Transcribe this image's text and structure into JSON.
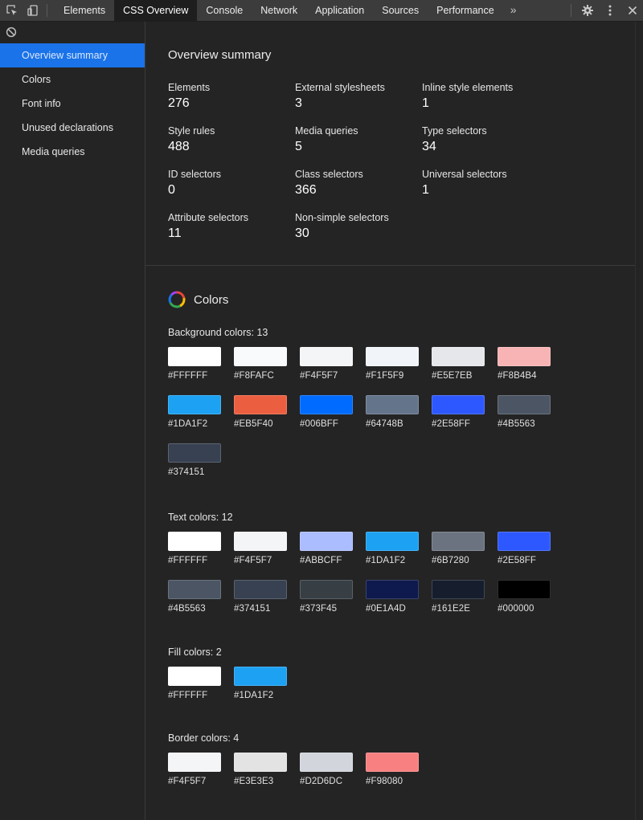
{
  "toolbar": {
    "tabs": [
      "Elements",
      "CSS Overview",
      "Console",
      "Network",
      "Application",
      "Sources",
      "Performance"
    ],
    "active_tab": "CSS Overview",
    "more_tabs": "»",
    "icons": [
      "inspect-element-icon",
      "device-toolbar-icon",
      "gear-icon",
      "kebab-menu-icon",
      "close-icon"
    ]
  },
  "sidebar": {
    "items": [
      "Overview summary",
      "Colors",
      "Font info",
      "Unused declarations",
      "Media queries"
    ],
    "active": "Overview summary"
  },
  "summary": {
    "title": "Overview summary",
    "stats": [
      {
        "label": "Elements",
        "value": "276"
      },
      {
        "label": "External stylesheets",
        "value": "3"
      },
      {
        "label": "Inline style elements",
        "value": "1"
      },
      {
        "label": "Style rules",
        "value": "488"
      },
      {
        "label": "Media queries",
        "value": "5"
      },
      {
        "label": "Type selectors",
        "value": "34"
      },
      {
        "label": "ID selectors",
        "value": "0"
      },
      {
        "label": "Class selectors",
        "value": "366"
      },
      {
        "label": "Universal selectors",
        "value": "1"
      },
      {
        "label": "Attribute selectors",
        "value": "11"
      },
      {
        "label": "Non-simple selectors",
        "value": "30"
      }
    ]
  },
  "colors": {
    "title": "Colors",
    "groups": [
      {
        "title": "Background colors: 13",
        "colors": [
          "#FFFFFF",
          "#F8FAFC",
          "#F4F5F7",
          "#F1F5F9",
          "#E5E7EB",
          "#F8B4B4",
          "#1DA1F2",
          "#EB5F40",
          "#006BFF",
          "#64748B",
          "#2E58FF",
          "#4B5563",
          "#374151"
        ]
      },
      {
        "title": "Text colors: 12",
        "colors": [
          "#FFFFFF",
          "#F4F5F7",
          "#ABBCFF",
          "#1DA1F2",
          "#6B7280",
          "#2E58FF",
          "#4B5563",
          "#374151",
          "#373F45",
          "#0E1A4D",
          "#161E2E",
          "#000000"
        ]
      },
      {
        "title": "Fill colors: 2",
        "colors": [
          "#FFFFFF",
          "#1DA1F2"
        ]
      },
      {
        "title": "Border colors: 4",
        "colors": [
          "#F4F5F7",
          "#E3E3E3",
          "#D2D6DC",
          "#F98080"
        ]
      }
    ]
  },
  "theme": {
    "accent": "#1a73e8",
    "panel_bg": "#242424",
    "toolbar_bg": "#3c3c3c"
  }
}
